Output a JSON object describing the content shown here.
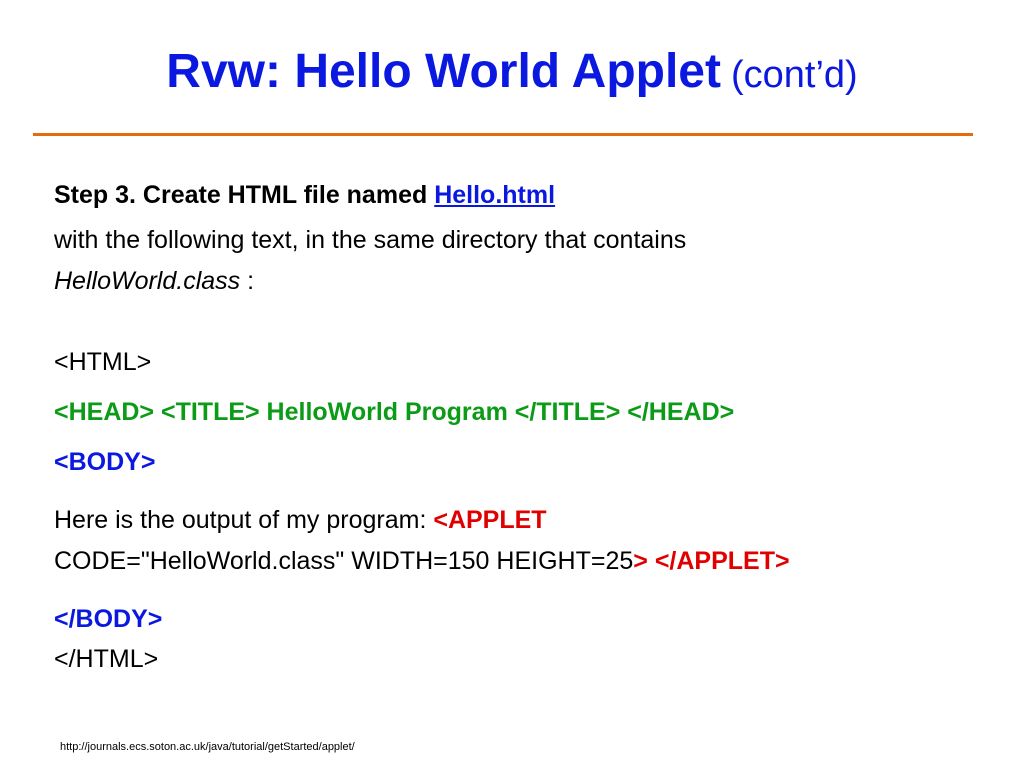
{
  "slide": {
    "title_main": "Rvw:  Hello World Applet",
    "title_sub": "(cont’d)",
    "step_heading": "Step 3. Create HTML file named ",
    "step_link": "Hello.html",
    "instruction_line1": "with the following text, in the same directory that contains",
    "instruction_class": "HelloWorld.class",
    "instruction_colon": " :",
    "code": {
      "html_open": "<HTML>",
      "head_line": "<HEAD> <TITLE> HelloWorld Program </TITLE> </HEAD>",
      "body_open": "<BODY>",
      "output_text": "Here is the output of my program:  ",
      "applet_open": "<APPLET",
      "applet_attrs": "CODE=\"HelloWorld.class\" WIDTH=150 HEIGHT=25",
      "applet_gt": ">",
      "applet_close": " </APPLET>",
      "body_close": "</BODY>",
      "html_close": "</HTML>"
    },
    "footer_url": "http://journals.ecs.soton.ac.uk/java/tutorial/getStarted/applet/"
  },
  "colors": {
    "title": "#0b18e0",
    "rule": "#e46c0a",
    "green_code": "#0b9b16",
    "blue_code": "#0b18e0",
    "red_code": "#e00000"
  }
}
